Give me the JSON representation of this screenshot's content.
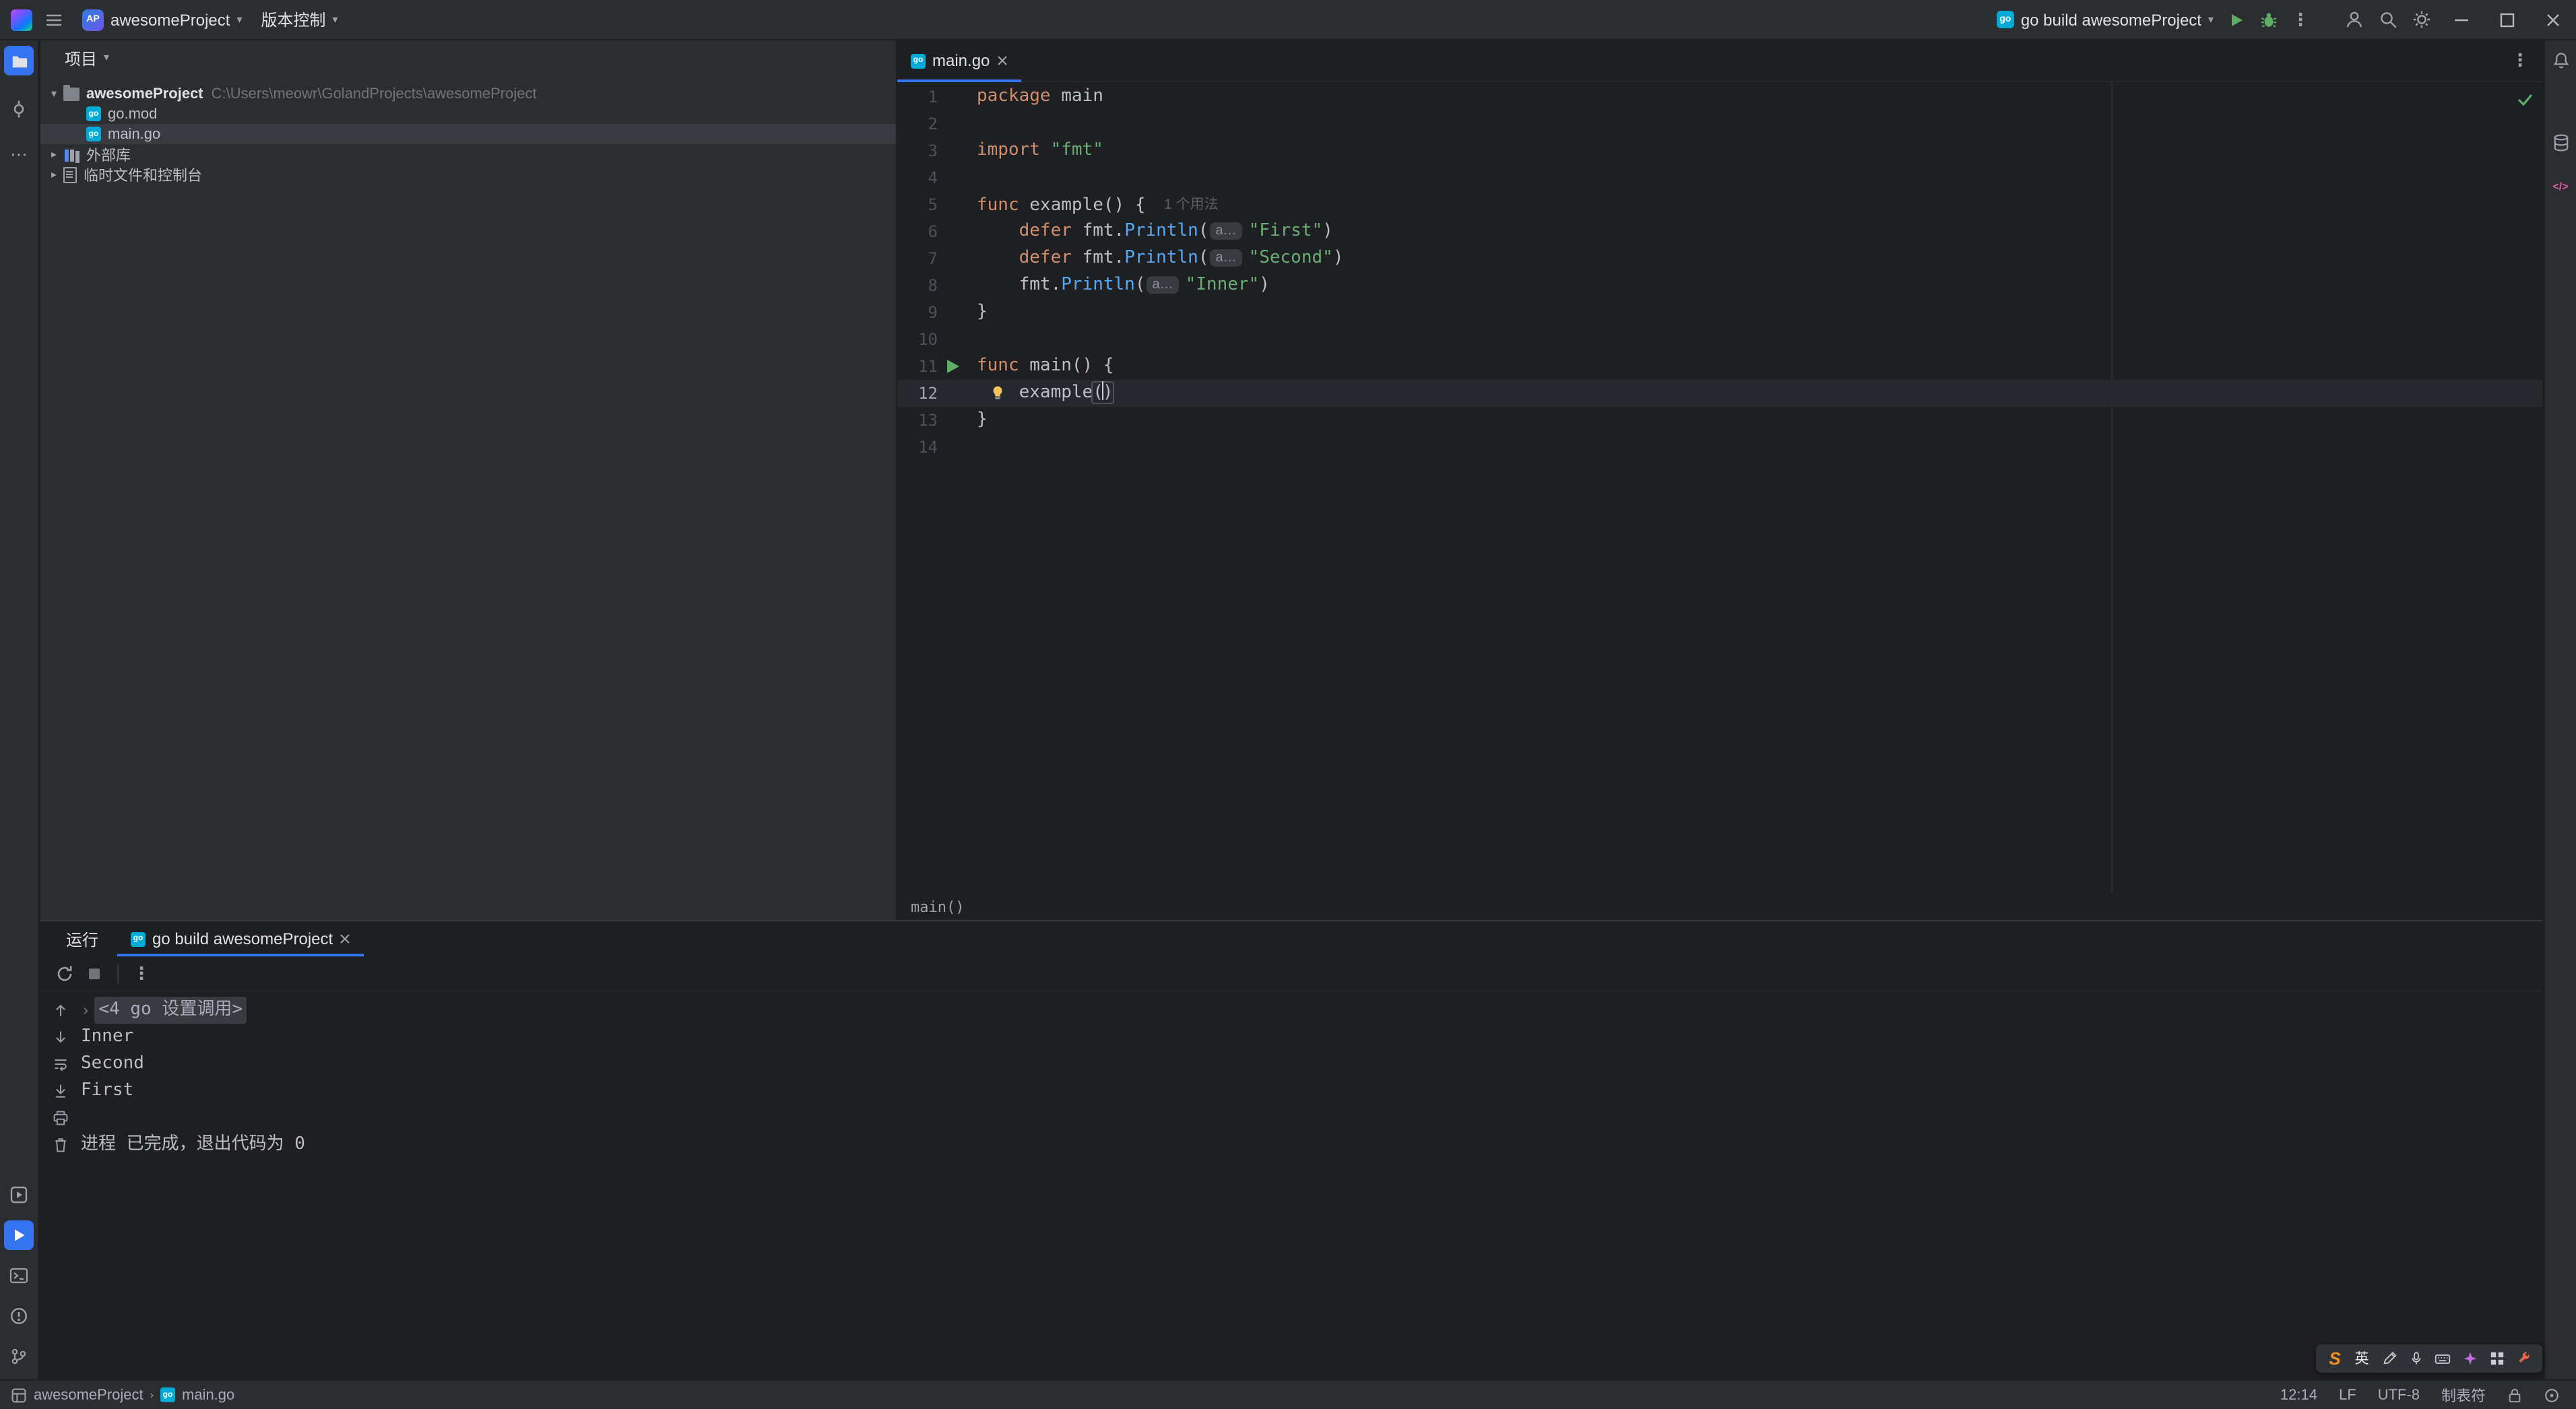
{
  "title_bar": {
    "project_badge": "AP",
    "project_name": "awesomeProject",
    "vcs_label": "版本控制",
    "run_config": "go build awesomeProject"
  },
  "project_panel": {
    "header": "项目",
    "tree": [
      {
        "id": "root",
        "type": "root",
        "chev": "down",
        "icon": "folder",
        "label": "awesomeProject",
        "path": "C:\\Users\\meowr\\GolandProjects\\awesomeProject"
      },
      {
        "id": "go-mod",
        "type": "file",
        "icon": "go",
        "label": "go.mod"
      },
      {
        "id": "main-go",
        "type": "file",
        "icon": "go",
        "label": "main.go",
        "selected": true
      },
      {
        "id": "external-libraries",
        "type": "node",
        "chev": "right",
        "icon": "lib",
        "label": "外部库"
      },
      {
        "id": "scratches",
        "type": "node",
        "chev": "right",
        "icon": "scratch",
        "label": "临时文件和控制台"
      }
    ]
  },
  "editor": {
    "tab_label": "main.go",
    "breadcrumb": "main()",
    "lines": [
      {
        "n": 1,
        "segs": [
          [
            "kw",
            "package "
          ],
          [
            "pl",
            "main"
          ]
        ]
      },
      {
        "n": 2,
        "segs": []
      },
      {
        "n": 3,
        "segs": [
          [
            "kw",
            "import "
          ],
          [
            "str",
            "\"fmt\""
          ]
        ]
      },
      {
        "n": 4,
        "segs": []
      },
      {
        "n": 5,
        "segs": [
          [
            "kw",
            "func "
          ],
          [
            "pl",
            "example() { "
          ],
          [
            "hint",
            "1 个用法"
          ]
        ]
      },
      {
        "n": 6,
        "segs": [
          [
            "pl",
            "    "
          ],
          [
            "kw",
            "defer "
          ],
          [
            "pl",
            "fmt."
          ],
          [
            "call",
            "Println"
          ],
          [
            "pl",
            "("
          ],
          [
            "inlay",
            "a…"
          ],
          [
            "str",
            "\"First\""
          ],
          [
            "pl",
            ")"
          ]
        ]
      },
      {
        "n": 7,
        "segs": [
          [
            "pl",
            "    "
          ],
          [
            "kw",
            "defer "
          ],
          [
            "pl",
            "fmt."
          ],
          [
            "call",
            "Println"
          ],
          [
            "pl",
            "("
          ],
          [
            "inlay",
            "a…"
          ],
          [
            "str",
            "\"Second\""
          ],
          [
            "pl",
            ")"
          ]
        ]
      },
      {
        "n": 8,
        "segs": [
          [
            "pl",
            "    "
          ],
          [
            "pl",
            "fmt."
          ],
          [
            "call",
            "Println"
          ],
          [
            "pl",
            "("
          ],
          [
            "inlay",
            "a…"
          ],
          [
            "str",
            "\"Inner\""
          ],
          [
            "pl",
            ")"
          ]
        ]
      },
      {
        "n": 9,
        "segs": [
          [
            "pl",
            "}"
          ]
        ]
      },
      {
        "n": 10,
        "segs": []
      },
      {
        "n": 11,
        "gutter": "run",
        "segs": [
          [
            "kw",
            "func "
          ],
          [
            "pl",
            "main() {"
          ]
        ]
      },
      {
        "n": 12,
        "current": true,
        "bulb": true,
        "segs": [
          [
            "pl",
            "    "
          ],
          [
            "pl",
            "example"
          ],
          [
            "paren",
            "()"
          ]
        ]
      },
      {
        "n": 13,
        "segs": [
          [
            "pl",
            "}"
          ]
        ]
      },
      {
        "n": 14,
        "segs": []
      }
    ]
  },
  "run_panel": {
    "title": "运行",
    "tab_label": "go build awesomeProject",
    "console": [
      {
        "type": "folded",
        "text": "<4 go 设置调用>"
      },
      {
        "type": "out",
        "text": "Inner"
      },
      {
        "type": "out",
        "text": "Second"
      },
      {
        "type": "out",
        "text": "First"
      },
      {
        "type": "blank",
        "text": ""
      },
      {
        "type": "out",
        "text": "进程 已完成，退出代码为 0"
      }
    ]
  },
  "status_bar": {
    "project": "awesomeProject",
    "file": "main.go",
    "position": "12:14",
    "line_separator": "LF",
    "encoding": "UTF-8",
    "indent": "制表符"
  },
  "ime": {
    "logo": "S",
    "lang": "英"
  },
  "icons": {
    "title_bar": [
      "goland-logo",
      "menu",
      "chevron-down",
      "go-gopher",
      "run",
      "debug",
      "more",
      "user",
      "search",
      "settings",
      "minimize",
      "maximize",
      "close"
    ],
    "left_stripe": [
      "project-folder",
      "commit",
      "more",
      "services",
      "run",
      "terminal",
      "problems",
      "git-branch"
    ],
    "right_stripe": [
      "notifications-bell",
      "database",
      "ai-assistant"
    ],
    "run_toolbar": [
      "rerun",
      "stop",
      "more"
    ],
    "console_toolbar": [
      "up-arrow",
      "down-arrow",
      "soft-wrap",
      "scroll-to-end",
      "print",
      "clear"
    ],
    "status_bar": [
      "workspace",
      "go-file",
      "lock",
      "status-indicator"
    ],
    "ime": [
      "sogou-logo",
      "pencil",
      "mic",
      "keyboard",
      "sparkle",
      "grid",
      "wrench"
    ]
  }
}
